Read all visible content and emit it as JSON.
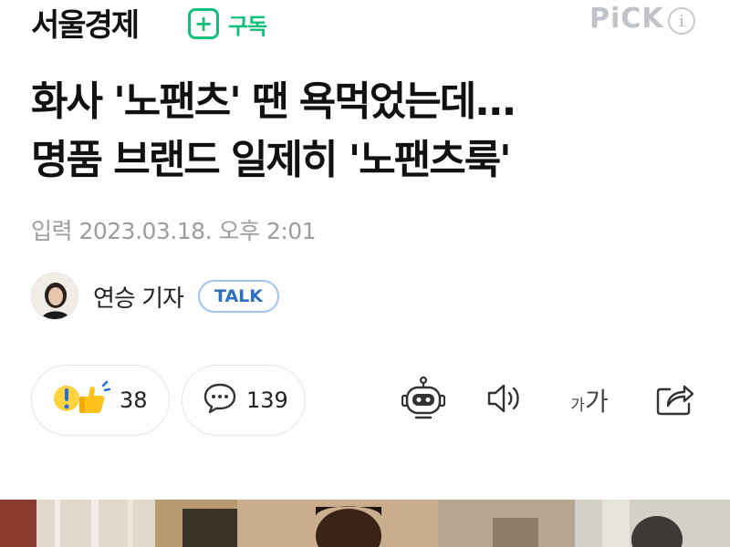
{
  "header": {
    "press_name": "서울경제",
    "subscribe_label": "구독",
    "pick_label": "PiCK",
    "info_symbol": "i"
  },
  "headline": {
    "line1": "화사 '노팬츠' 땐 욕먹었는데...",
    "line2": "명품 브랜드 일제히 '노팬츠룩'"
  },
  "dateline": "입력 2023.03.18. 오후 2:01",
  "reporter": {
    "name": "연승 기자",
    "talk_label": "TALK"
  },
  "actions": {
    "reaction_count": "38",
    "comment_count": "139"
  },
  "toolbar": {
    "font_small": "가",
    "font_big": "가"
  },
  "colors": {
    "brand_green": "#10c07a",
    "talk_blue": "#2f6fbf",
    "muted_gray": "#9a9da1"
  },
  "icons": [
    "plus-icon",
    "info-icon",
    "reaction-icon",
    "comment-icon",
    "robot-summary-icon",
    "speaker-icon",
    "font-size-icon",
    "share-icon"
  ]
}
